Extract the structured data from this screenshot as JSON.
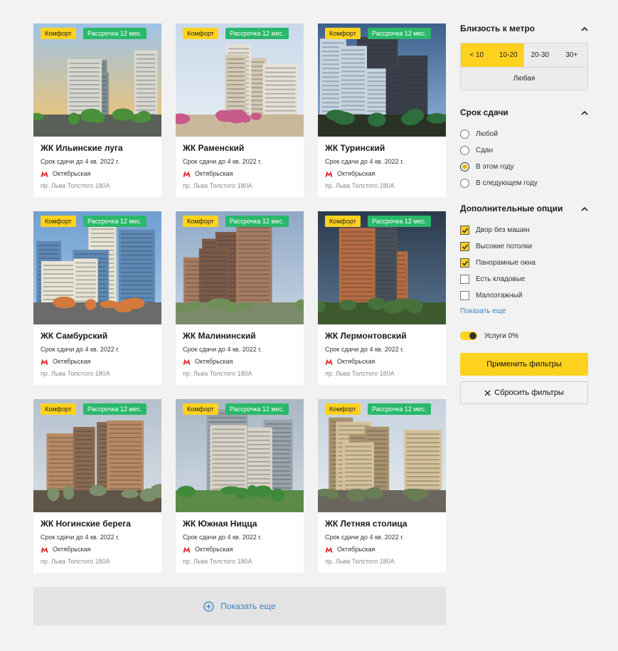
{
  "cards": [
    {
      "title": "ЖК Ильинские луга",
      "deadline": "Срок сдачи до 4 кв. 2022 г.",
      "metro": "Октябрьская",
      "address": "пр. Льва Толстого 180А",
      "badge_class": "Комфорт",
      "badge_installment": "Рассрочка 12 мес.",
      "palette": "sunset"
    },
    {
      "title": "ЖК Раменский",
      "deadline": "Срок сдачи до 4 кв. 2022 г.",
      "metro": "Октябрьская",
      "address": "пр. Льва Толстого 180А",
      "badge_class": "Комфорт",
      "badge_installment": "Рассрочка 12 мес.",
      "palette": "playground"
    },
    {
      "title": "ЖК Туринский",
      "deadline": "Срок сдачи до 4 кв. 2022 г.",
      "metro": "Октябрьская",
      "address": "пр. Льва Толстого 180А",
      "badge_class": "Комфорт",
      "badge_installment": "Рассрочка 12 мес.",
      "palette": "dusk"
    },
    {
      "title": "ЖК Самбурский",
      "deadline": "Срок сдачи до 4 кв. 2022 г.",
      "metro": "Октябрьская",
      "address": "пр. Льва Толстого 180А",
      "badge_class": "Комфорт",
      "badge_installment": "Рассрочка 12 мес.",
      "palette": "colorful"
    },
    {
      "title": "ЖК Малининский",
      "deadline": "Срок сдачи до 4 кв. 2022 г.",
      "metro": "Октябрьская",
      "address": "пр. Льва Толстого 180А",
      "badge_class": "Комфорт",
      "badge_installment": "Рассрочка 12 мес.",
      "palette": "brick"
    },
    {
      "title": "ЖК Лермонтовский",
      "deadline": "Срок сдачи до 4 кв. 2022 г.",
      "metro": "Октябрьская",
      "address": "пр. Льва Толстого 180А",
      "badge_class": "Комфорт",
      "badge_installment": "Рассрочка 12 мес.",
      "palette": "modern"
    },
    {
      "title": "ЖК Ногинские берега",
      "deadline": "Срок сдачи до 4 кв. 2022 г.",
      "metro": "Октябрьская",
      "address": "пр. Льва Толстого 180А",
      "badge_class": "Комфорт",
      "badge_installment": "Рассрочка 12 мес.",
      "palette": "tan"
    },
    {
      "title": "ЖК Южная Ницца",
      "deadline": "Срок сдачи до 4 кв. 2022 г.",
      "metro": "Октябрьская",
      "address": "пр. Льва Толстого 180А",
      "badge_class": "Комфорт",
      "badge_installment": "Рассрочка 12 мес.",
      "palette": "aerial"
    },
    {
      "title": "ЖК Летняя столица",
      "deadline": "Срок сдачи до 4 кв. 2022 г.",
      "metro": "Октябрьская",
      "address": "пр. Льва Толстого 180А",
      "badge_class": "Комфорт",
      "badge_installment": "Рассрочка 12 мес.",
      "palette": "beige"
    }
  ],
  "show_more_label": "Показать еще",
  "filters": {
    "metro": {
      "title": "Близость к метро",
      "options": [
        "< 10",
        "10-20",
        "20-30",
        "30+"
      ],
      "selected": [
        "< 10",
        "10-20"
      ],
      "any_label": "Любая"
    },
    "deadline": {
      "title": "Срок сдачи",
      "options": [
        "Любой",
        "Сдан",
        "В этом году",
        "В следующем году"
      ],
      "selected": "В этом году"
    },
    "extra": {
      "title": "Дополнительные опции",
      "options": [
        {
          "label": "Двор без машин",
          "checked": true
        },
        {
          "label": "Высокие потолки",
          "checked": true
        },
        {
          "label": "Панорамные окна",
          "checked": true
        },
        {
          "label": "Есть кладовые",
          "checked": false
        },
        {
          "label": "Малоэтажный",
          "checked": false
        }
      ],
      "show_more": "Показать еще"
    },
    "services_toggle": {
      "label": "Услуги 0%",
      "on": true
    },
    "apply_label": "Применить фильтры",
    "reset_label": "Сбросить фильтры"
  },
  "colors": {
    "accent_yellow": "#ffd21f",
    "badge_green": "#2ab86b",
    "link_blue": "#3d7fc1",
    "metro_red": "#e52b2b"
  }
}
